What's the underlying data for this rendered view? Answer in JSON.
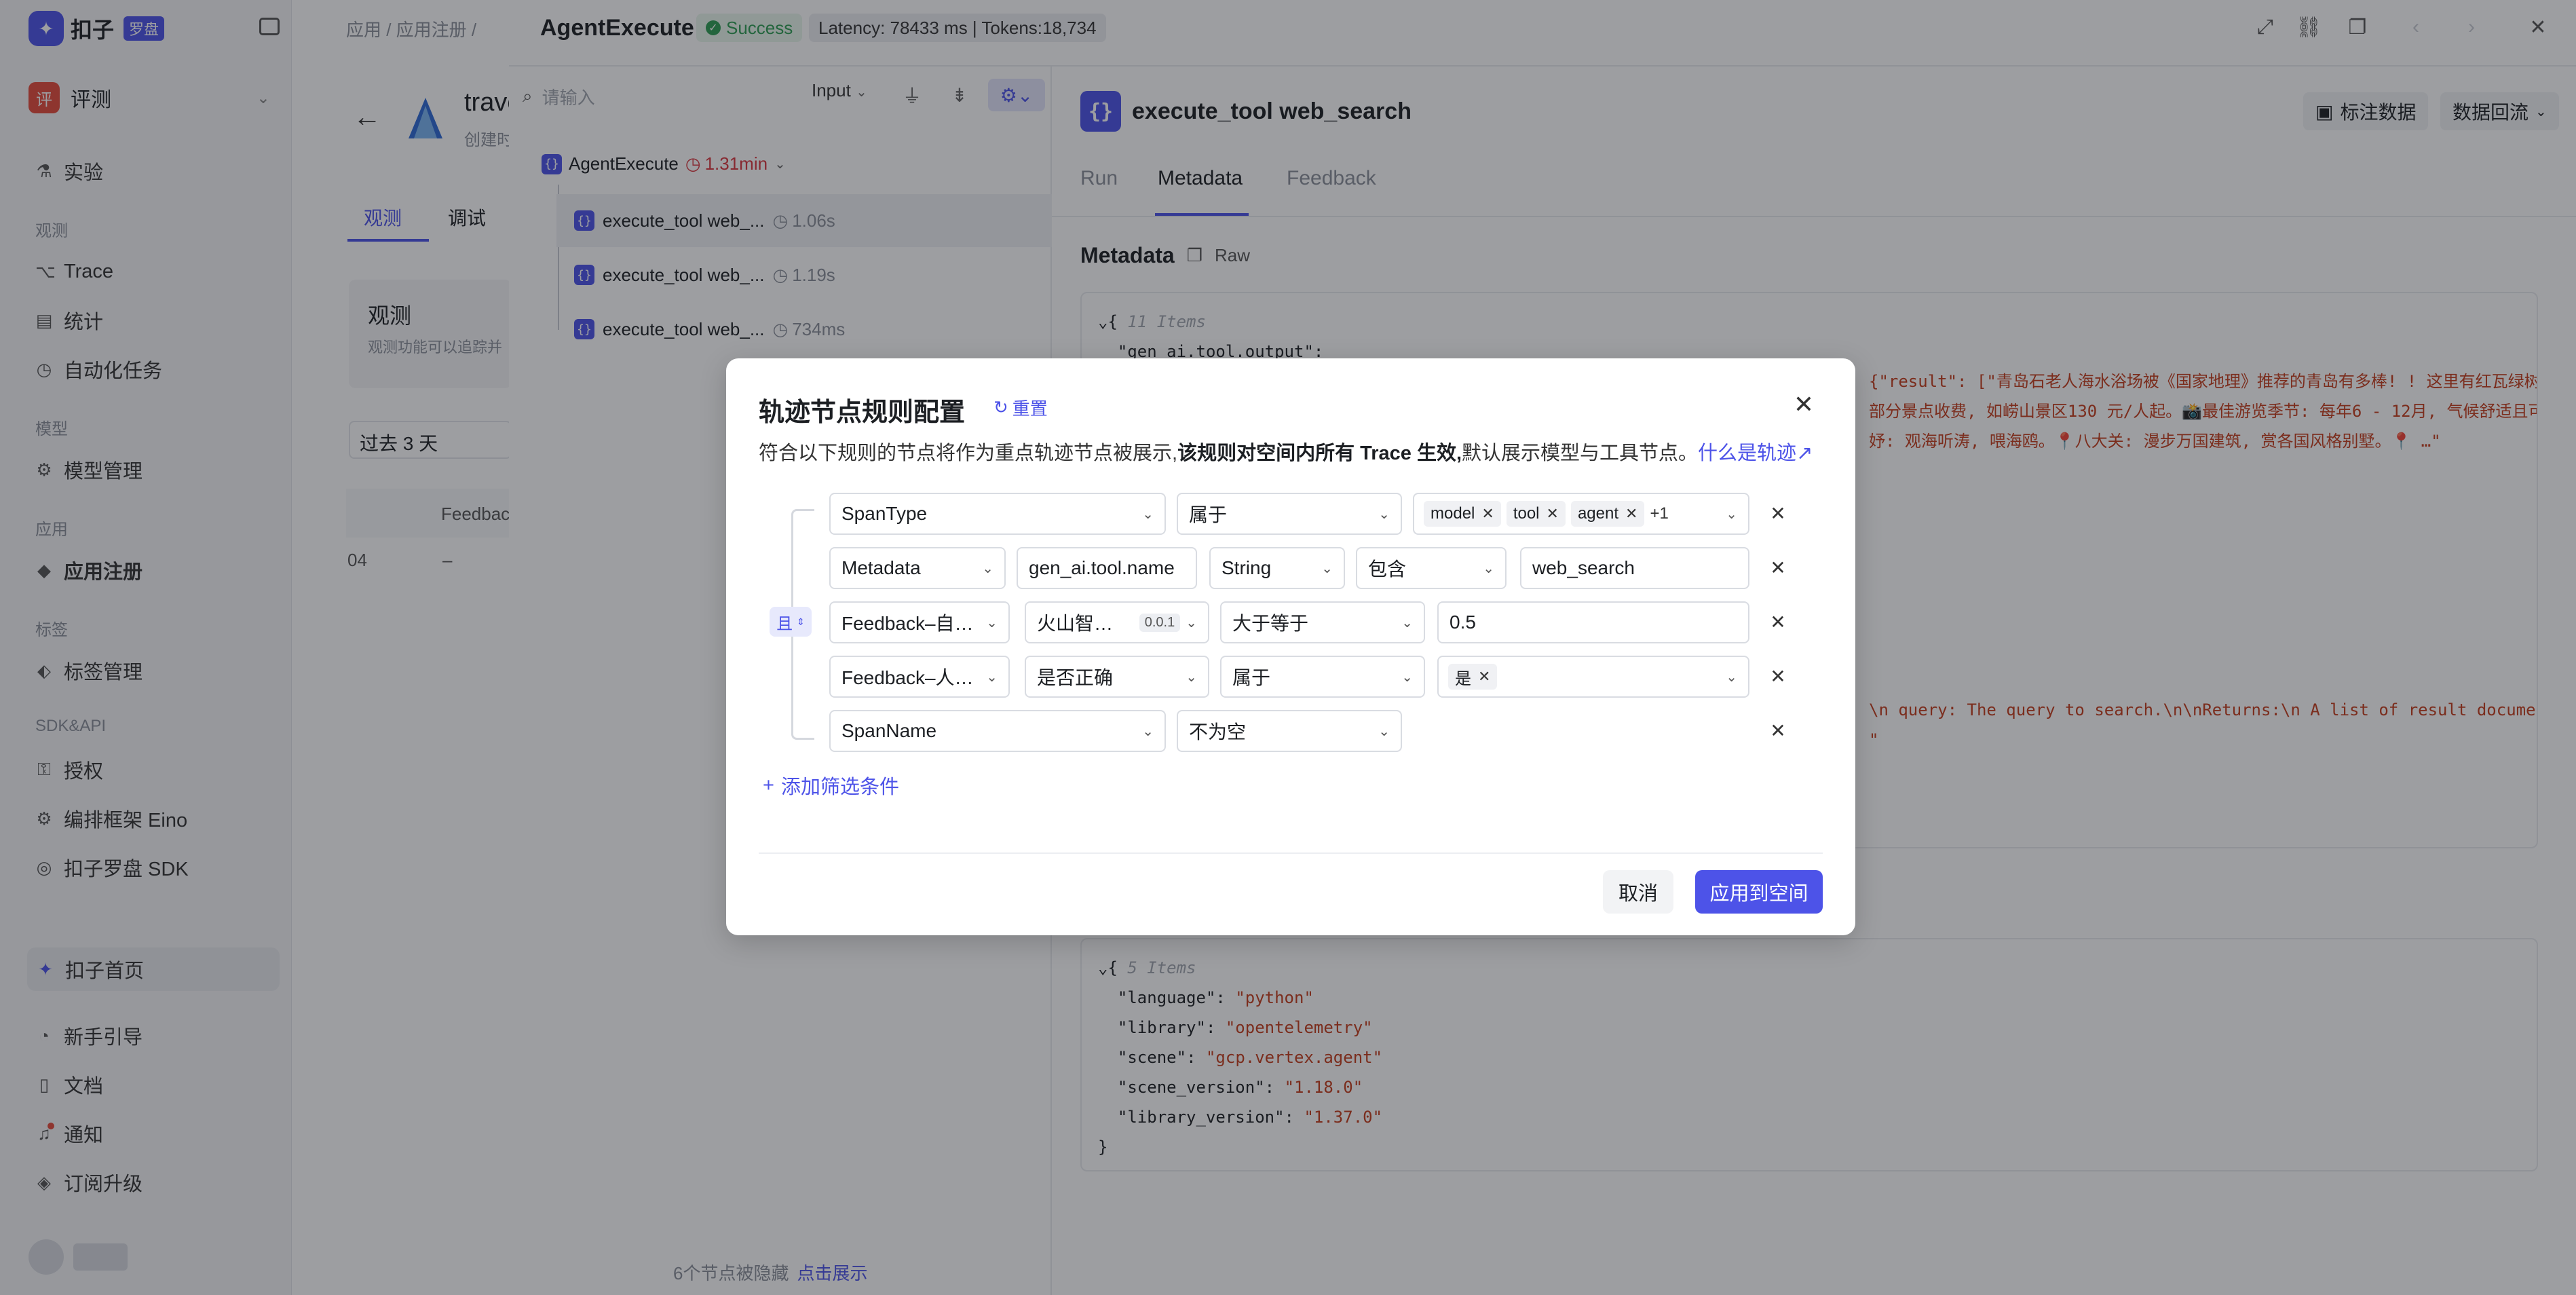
{
  "sidebar": {
    "logo_text": "扣子",
    "logo_tag": "罗盘",
    "space_name": "评测",
    "space_avatar": "评",
    "items": [
      {
        "label": "实验",
        "icon": "flask-icon"
      },
      {
        "group": "观测"
      },
      {
        "label": "Trace",
        "icon": "trace-icon"
      },
      {
        "label": "统计",
        "icon": "stats-icon"
      },
      {
        "label": "自动化任务",
        "icon": "automation-icon"
      },
      {
        "group": "模型"
      },
      {
        "label": "模型管理",
        "icon": "model-icon"
      },
      {
        "group": "应用"
      },
      {
        "label": "应用注册",
        "icon": "app-register-icon"
      },
      {
        "group": "标签"
      },
      {
        "label": "标签管理",
        "icon": "tag-icon"
      },
      {
        "group": "SDK&API"
      },
      {
        "label": "授权",
        "icon": "key-icon"
      },
      {
        "label": "编排框架 Eino",
        "icon": "eino-icon"
      },
      {
        "label": "扣子罗盘 SDK",
        "icon": "sdk-icon"
      }
    ],
    "home": "扣子首页",
    "bottom": [
      {
        "label": "新手引导",
        "icon": "guide-icon"
      },
      {
        "label": "文档",
        "icon": "doc-icon"
      },
      {
        "label": "通知",
        "icon": "bell-icon"
      },
      {
        "label": "订阅升级",
        "icon": "upgrade-icon"
      }
    ]
  },
  "background_page": {
    "breadcrumb": "应用 / 应用注册 /",
    "app_name": "trave",
    "app_sub": "创建时",
    "tabs": [
      "观测",
      "调试"
    ],
    "card_title": "观测",
    "card_sub": "观测功能可以追踪并",
    "time_select": "过去 3 天",
    "column_header": "Feedbac",
    "cell_left": "04",
    "cell_dash": "–"
  },
  "drawer": {
    "title": "AgentExecute",
    "status": "Success",
    "metrics": "Latency: 78433 ms | Tokens:18,734",
    "search_placeholder": "请输入",
    "filter_select": "Input",
    "tree": {
      "root_name": "AgentExecute",
      "root_duration": "1.31min",
      "children": [
        {
          "name": "execute_tool web_...",
          "duration": "1.06s"
        },
        {
          "name": "execute_tool web_...",
          "duration": "1.19s"
        },
        {
          "name": "execute_tool web_...",
          "duration": "734ms"
        }
      ]
    },
    "hidden_note": "6个节点被隐藏",
    "hidden_link": "点击展示",
    "detail": {
      "title": "execute_tool web_search",
      "mark_button": "标注数据",
      "data_button": "数据回流",
      "tabs": [
        "Run",
        "Metadata",
        "Feedback"
      ],
      "active_tab": "Metadata",
      "section_title": "Metadata",
      "raw_label": "Raw",
      "json1_count": "11 Items",
      "json1_key": "\"gen_ai.tool.output\":",
      "json1_line1": "{\"result\": [\"青岛石老人海水浴场被《国家地理》推荐的青岛有多棒! ! 这里有红瓦绿树的",
      "json1_line2": "部分景点收费, 如崂山景区130 元/人起。📸最佳游览季节: 每年6 - 12月, 气候舒适且可畅",
      "json1_line3": "妤: 观海听涛, 喂海鸥。📍八大关: 漫步万国建筑, 赏各国风格别墅。📍 …\"",
      "json1_line4": "\\n query: The query to search.\\n\\nReturns:\\n A list of result documen",
      "json2_count": "5 Items",
      "json2": [
        {
          "k": "\"language\"",
          "v": "\"python\""
        },
        {
          "k": "\"library\"",
          "v": "\"opentelemetry\""
        },
        {
          "k": "\"scene\"",
          "v": "\"gcp.vertex.agent\""
        },
        {
          "k": "\"scene_version\"",
          "v": "\"1.18.0\""
        },
        {
          "k": "\"library_version\"",
          "v": "\"1.37.0\""
        }
      ]
    }
  },
  "modal": {
    "title": "轨迹节点规则配置",
    "reset": "重置",
    "desc_prefix": "符合以下规则的节点将作为重点轨迹节点被展示,",
    "desc_bold": "该规则对空间内所有 Trace 生效,",
    "desc_suffix": "默认展示模型与工具节点。",
    "desc_link": "什么是轨迹",
    "logic": "且",
    "rows": [
      {
        "field": "SpanType",
        "op": "属于",
        "tags": [
          "model",
          "tool",
          "agent"
        ],
        "more": "+1"
      },
      {
        "field": "Metadata",
        "key": "gen_ai.tool.name",
        "type": "String",
        "op": "包含",
        "value": "web_search"
      },
      {
        "field": "Feedback–自…",
        "evaluator": "火山智…",
        "version": "0.0.1",
        "op": "大于等于",
        "value": "0.5"
      },
      {
        "field": "Feedback–人…",
        "key": "是否正确",
        "op": "属于",
        "tags": [
          "是"
        ]
      },
      {
        "field": "SpanName",
        "op": "不为空"
      }
    ],
    "add_condition": "添加筛选条件",
    "cancel": "取消",
    "apply": "应用到空间"
  }
}
